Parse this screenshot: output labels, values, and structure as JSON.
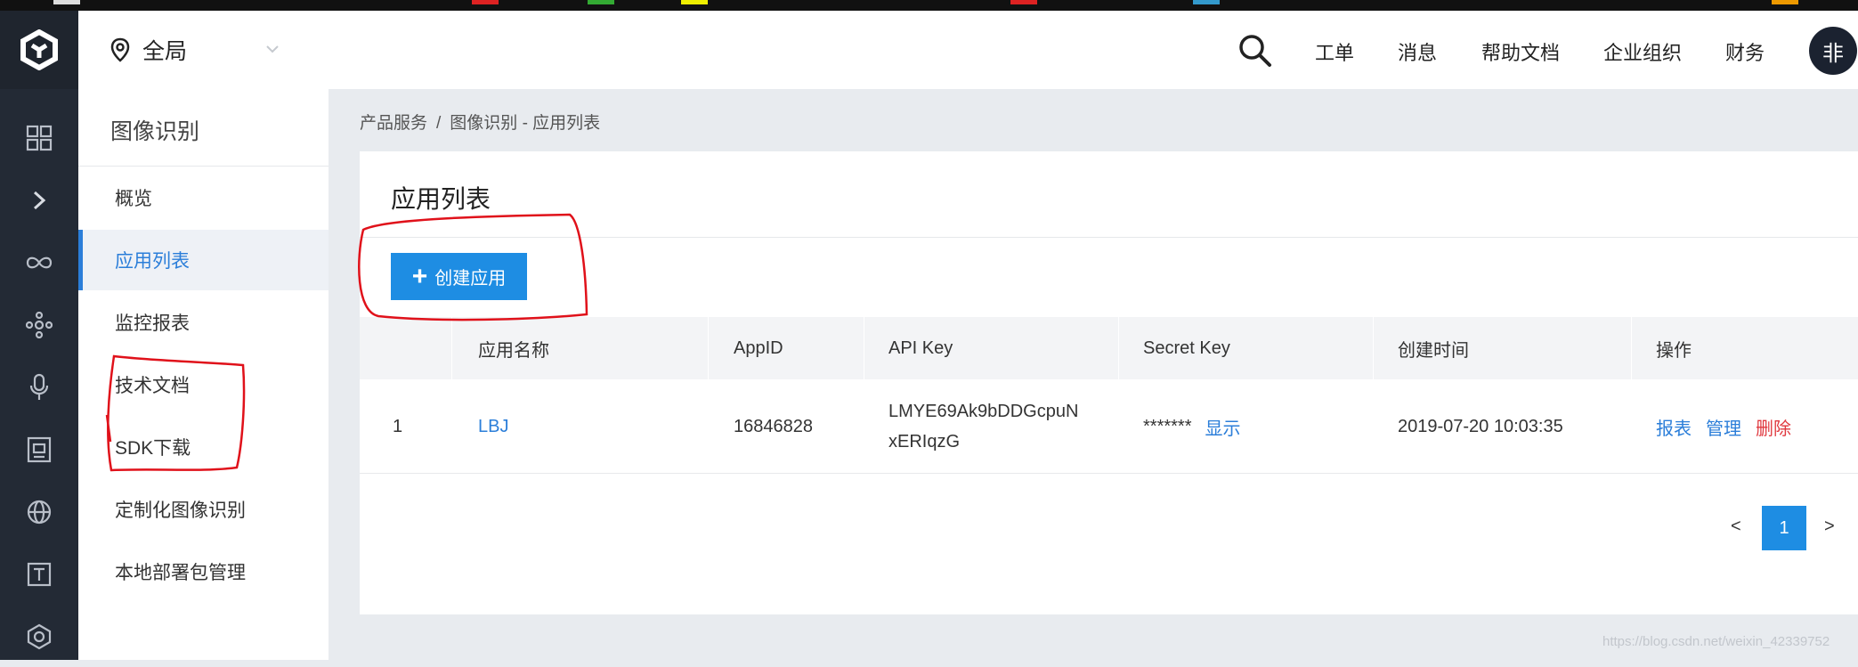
{
  "header": {
    "region_label": "全局",
    "nav": [
      "工单",
      "消息",
      "帮助文档",
      "企业组织",
      "财务"
    ],
    "avatar_text": "非"
  },
  "rail": {
    "icons": [
      "logo-icon",
      "dashboard-grid-icon",
      "expand-chevron-icon",
      "infinity-icon",
      "network-nodes-icon",
      "microphone-icon",
      "image-frame-icon",
      "globe-icon",
      "text-t-icon",
      "hexagon-icon"
    ]
  },
  "sidebar": {
    "title": "图像识别",
    "items": [
      {
        "label": "概览"
      },
      {
        "label": "应用列表"
      },
      {
        "label": "监控报表"
      },
      {
        "label": "技术文档"
      },
      {
        "label": "SDK下载"
      },
      {
        "label": "定制化图像识别"
      },
      {
        "label": "本地部署包管理"
      }
    ]
  },
  "breadcrumb": {
    "root": "产品服务",
    "sep": "/",
    "current": "图像识别 - 应用列表"
  },
  "main": {
    "title": "应用列表",
    "create_button": "创建应用",
    "columns": [
      "应用名称",
      "AppID",
      "API Key",
      "Secret Key",
      "创建时间",
      "操作"
    ],
    "rows": [
      {
        "index": "1",
        "name": "LBJ",
        "app_id": "16846828",
        "api_key_line1": "LMYE69Ak9bDDGcpuN",
        "api_key_line2": "xERIqzG",
        "secret_masked": "*******",
        "secret_show": "显示",
        "created": "2019-07-20 10:03:35",
        "actions": [
          "报表",
          "管理",
          "删除"
        ]
      }
    ],
    "pagination": {
      "prev": "<",
      "current": "1",
      "next": ">"
    }
  },
  "watermark": "https://blog.csdn.net/weixin_42339752",
  "colors": {
    "accent": "#1e8de3",
    "link": "#2b7ed9",
    "danger": "#e0383e",
    "rail": "#232a35",
    "annotation": "#e0111a"
  }
}
